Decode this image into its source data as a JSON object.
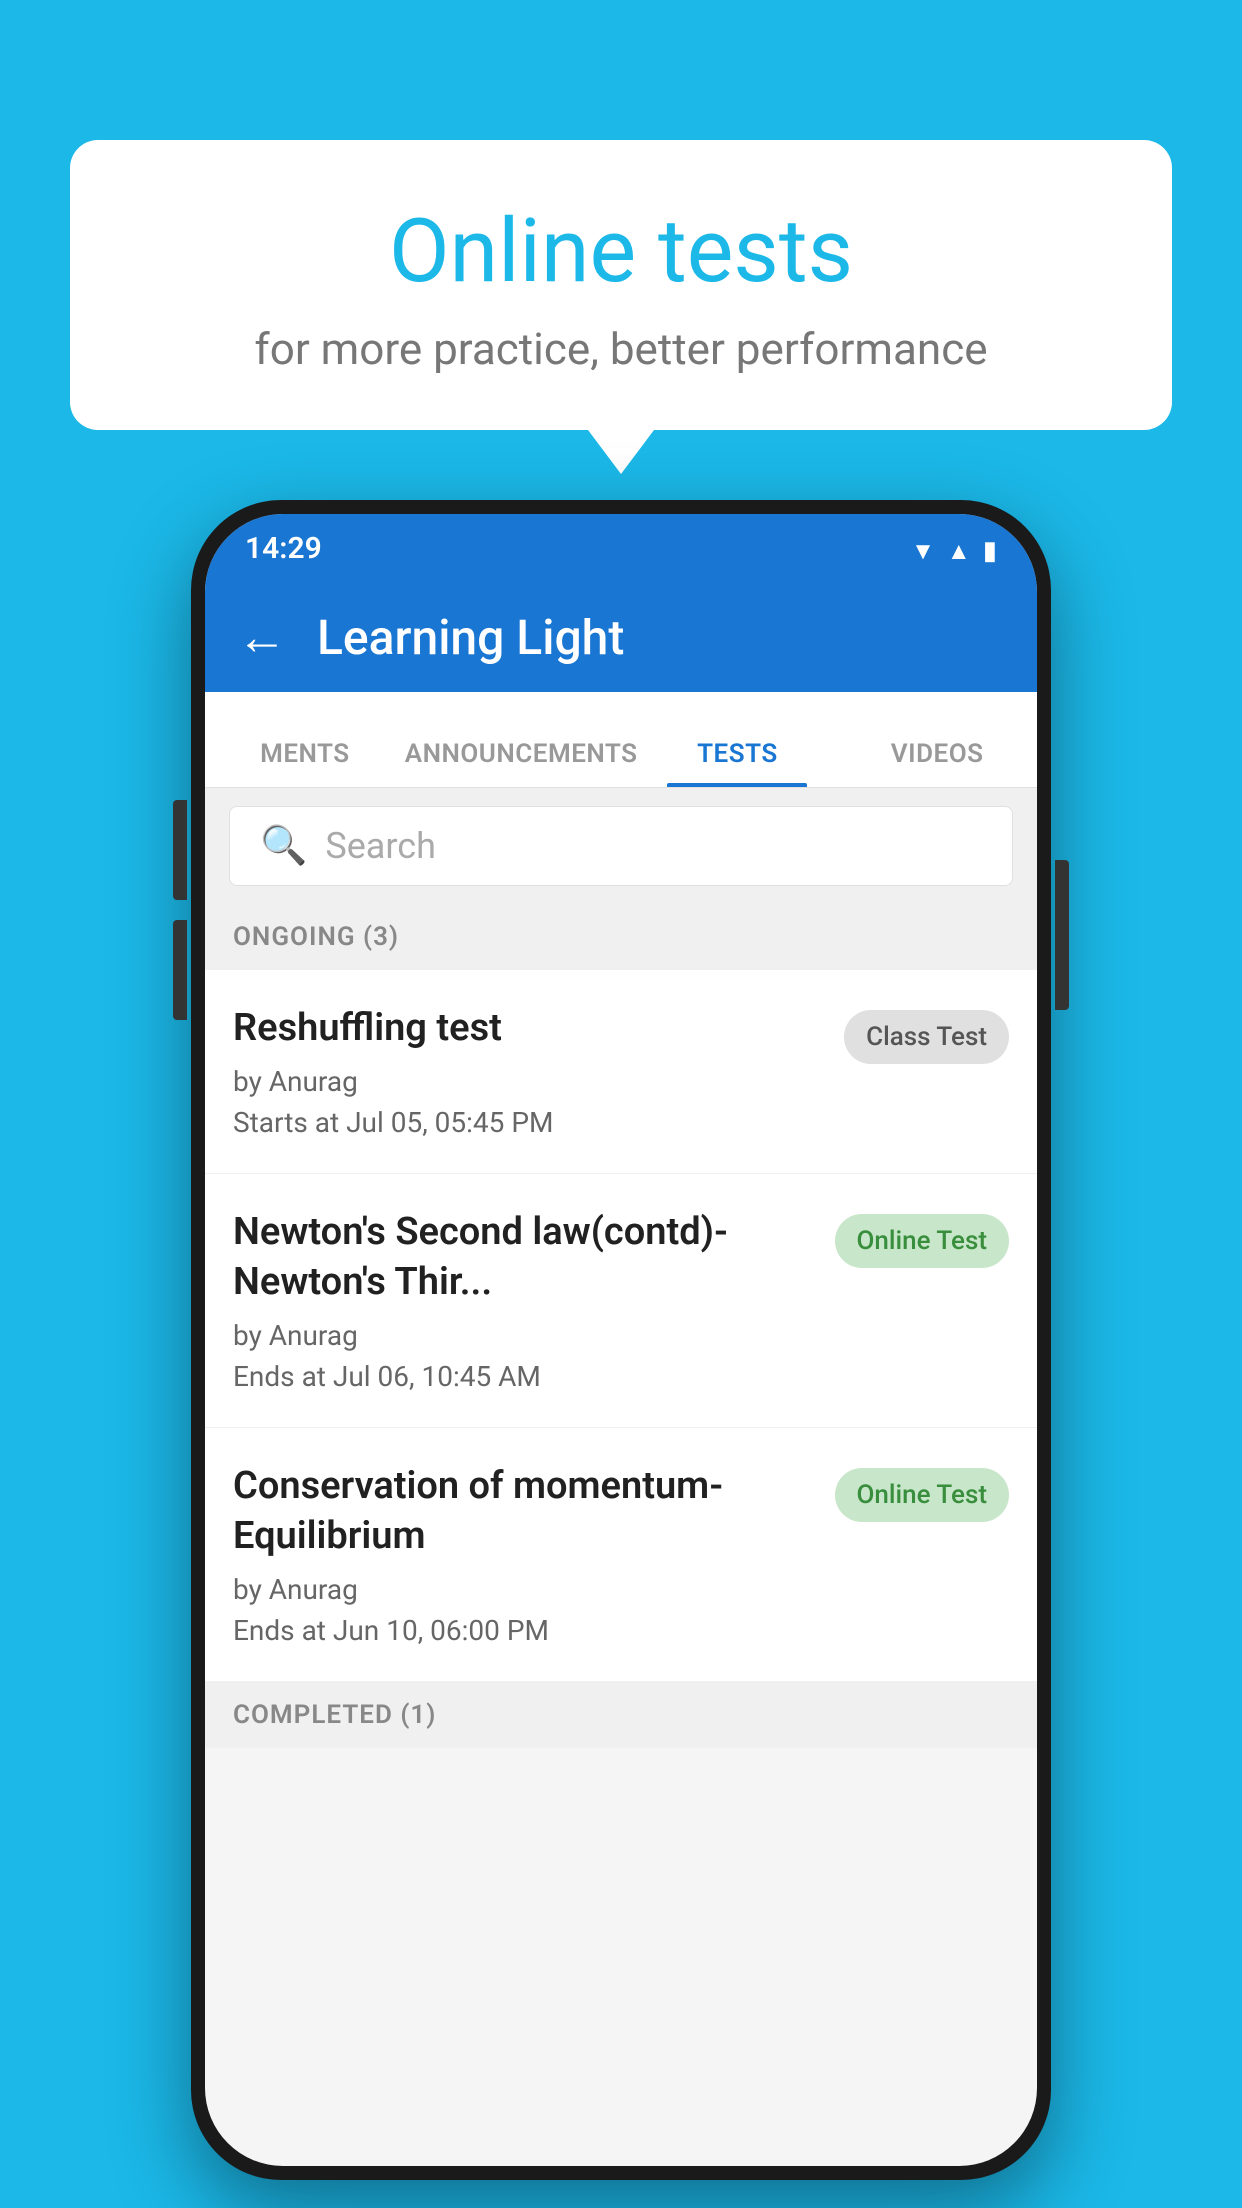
{
  "background_color": "#1BB8E8",
  "speech_bubble": {
    "title": "Online tests",
    "subtitle": "for more practice, better performance"
  },
  "phone": {
    "status_bar": {
      "time": "14:29",
      "wifi_icon": "wifi",
      "signal_icon": "signal",
      "battery_icon": "battery"
    },
    "app_bar": {
      "back_label": "←",
      "title": "Learning Light"
    },
    "tabs": [
      {
        "label": "MENTS",
        "active": false
      },
      {
        "label": "ANNOUNCEMENTS",
        "active": false
      },
      {
        "label": "TESTS",
        "active": true
      },
      {
        "label": "VIDEOS",
        "active": false
      }
    ],
    "search": {
      "placeholder": "Search"
    },
    "sections": [
      {
        "header": "ONGOING (3)",
        "items": [
          {
            "name": "Reshuffling test",
            "author": "by Anurag",
            "time_label": "Starts at",
            "time": "Jul 05, 05:45 PM",
            "badge": "Class Test",
            "badge_type": "class"
          },
          {
            "name": "Newton's Second law(contd)-Newton's Thir...",
            "author": "by Anurag",
            "time_label": "Ends at",
            "time": "Jul 06, 10:45 AM",
            "badge": "Online Test",
            "badge_type": "online"
          },
          {
            "name": "Conservation of momentum-Equilibrium",
            "author": "by Anurag",
            "time_label": "Ends at",
            "time": "Jun 10, 06:00 PM",
            "badge": "Online Test",
            "badge_type": "online"
          }
        ]
      }
    ],
    "completed_header": "COMPLETED (1)"
  }
}
